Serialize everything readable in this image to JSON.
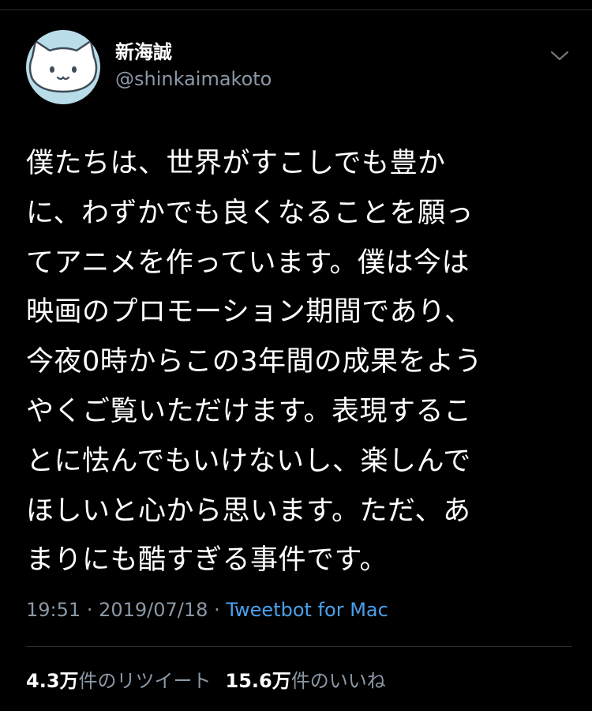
{
  "user": {
    "display_name": "新海誠",
    "handle": "@shinkaimakoto",
    "avatar": "white-cat-face-icon-on-light-blue"
  },
  "menu": {
    "icon": "chevron-down-icon"
  },
  "tweet": {
    "lines": [
      "僕たちは、世界がすこしでも豊か",
      "に、わずかでも良くなることを願っ",
      "てアニメを作っています。僕は今は",
      "映画のプロモーション期間であり、",
      "今夜0時からこの3年間の成果をよう",
      "やくご覧いただけます。表現するこ",
      "とに怯んでもいけないし、楽しんで",
      "ほしいと心から思います。ただ、あ",
      "まりにも酷すぎる事件です。"
    ],
    "time": "19:51",
    "date": "2019/07/18",
    "separator": "·",
    "client": "Tweetbot for Mac"
  },
  "stats": {
    "retweets_count": "4.3万",
    "retweets_label": "件のリツイート",
    "likes_count": "15.6万",
    "likes_label": "件のいいね"
  },
  "colors": {
    "background": "#000000",
    "text": "#ffffff",
    "secondary": "#8b98a5",
    "link": "#4ba0eb",
    "avatar_bg": "#b8dce8"
  }
}
